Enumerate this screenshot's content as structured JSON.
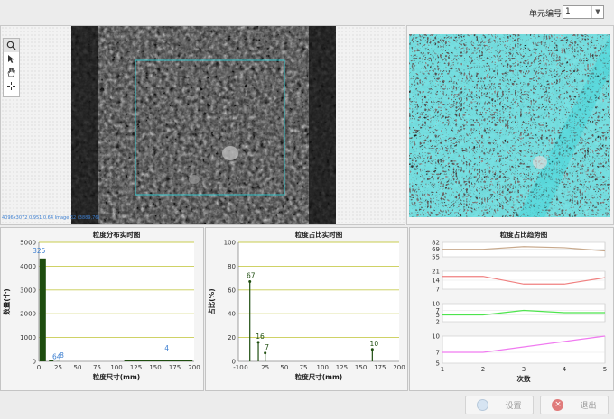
{
  "header": {
    "unit_label": "单元编号",
    "unit_value": "1",
    "unit_options": [
      "1"
    ]
  },
  "viewer": {
    "status_text": "4096x3072 0.951 0.64 Image 32  (3889,76)",
    "tools": [
      "zoom-icon",
      "pointer-icon",
      "hand-icon",
      "crosshair-icon"
    ]
  },
  "colors": {
    "accent_cyan": "#2fd1d6",
    "bar_green": "#1e4d0f",
    "grid_olive": "#c8cc50",
    "label_blue": "#3d7fd0"
  },
  "chart_data": [
    {
      "type": "bar",
      "title": "粒度分布实时图",
      "xlabel": "粒度尺寸(mm)",
      "ylabel": "数量(个)",
      "xlim": [
        0,
        200
      ],
      "ylim": [
        0,
        5000
      ],
      "xticks": [
        "0",
        "25",
        "50",
        "75",
        "100",
        "125",
        "150",
        "175",
        "200"
      ],
      "yticks": [
        "0",
        "1000",
        "2000",
        "3000",
        "4000",
        "5000"
      ],
      "x": [
        5,
        16,
        25,
        160
      ],
      "values": [
        4325,
        64,
        8,
        4
      ],
      "labels": [
        "325",
        "64",
        "8",
        "4"
      ],
      "grid": true
    },
    {
      "type": "bar",
      "title": "粒度占比实时图",
      "xlabel": "粒度尺寸(mm)",
      "ylabel": "占比(%)",
      "xlim": [
        -10,
        200
      ],
      "ylim": [
        0,
        100
      ],
      "xticks": [
        "-10",
        "0",
        "25",
        "50",
        "75",
        "100",
        "125",
        "150",
        "175",
        "200"
      ],
      "yticks": [
        "0",
        "20",
        "40",
        "60",
        "80",
        "100"
      ],
      "x": [
        5,
        16,
        25,
        165
      ],
      "values": [
        67,
        16,
        7,
        10
      ],
      "labels": [
        "67",
        "16",
        "7",
        "10"
      ],
      "grid": true
    },
    {
      "type": "line",
      "title": "粒度占比趋势图",
      "xlabel": "次数",
      "xlim": [
        1,
        5
      ],
      "xticks": [
        "1",
        "2",
        "3",
        "4",
        "5"
      ],
      "x": [
        1,
        2,
        3,
        4,
        5
      ],
      "series": [
        {
          "color": "#c8a98c",
          "ylim": [
            55,
            82
          ],
          "yticks": [
            "82",
            "69",
            "55"
          ],
          "values": [
            69,
            69,
            74,
            72,
            66
          ]
        },
        {
          "color": "#f08080",
          "ylim": [
            7,
            21
          ],
          "yticks": [
            "21",
            "14",
            "7"
          ],
          "values": [
            17,
            17,
            11,
            11,
            16
          ]
        },
        {
          "color": "#4ee44e",
          "ylim": [
            2,
            10
          ],
          "yticks": [
            "10",
            "7",
            "5",
            "2"
          ],
          "values": [
            5,
            5,
            7,
            6,
            6
          ]
        },
        {
          "color": "#f07af0",
          "ylim": [
            5,
            10
          ],
          "yticks": [
            "10",
            "7",
            "5"
          ],
          "values": [
            7,
            7,
            8,
            9,
            10
          ]
        }
      ],
      "grid": true
    }
  ],
  "buttons": {
    "settings": "设置",
    "exit": "退出"
  }
}
